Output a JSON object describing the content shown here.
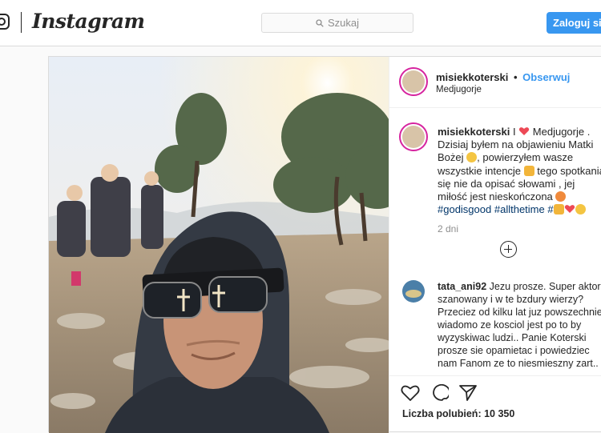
{
  "header": {
    "brand": "Instagram",
    "search_placeholder": "Szukaj",
    "login_label": "Zaloguj się"
  },
  "post": {
    "username": "misiekkoterski",
    "separator": "•",
    "follow_label": "Obserwuj",
    "location": "Medjugorje",
    "caption": {
      "username": "misiekkoterski",
      "t1": " I ",
      "t2": " Medjugorje . Dzisiaj byłem na objawieniu Matki Bożej ",
      "t3": ", powierzyłem wasze wszystkie intencje ",
      "t4": " tego spotkania się nie da opisać słowami , jej miłość jest nieskończona ",
      "hashtag1": "#godisgood",
      "hashtag2": "#allthetime",
      "hashtag3": "#"
    },
    "date": "2 dni",
    "comment": {
      "username": "tata_ani92",
      "text": "Jezu prosze. Super aktor szanowany i w te bzdury wierzy? Przeciez od kilku lat juz powszechnie wiadomo ze kosciol jest po to by wyzyskiwac ludzi.. Panie Koterski prosze sie opamietac i powiedziec nam Fanom ze to niesmieszny zart.."
    },
    "likes": "Liczba polubień: 10 350"
  },
  "colors": {
    "accent": "#3897f0",
    "ring": "#d6249f",
    "heart": "#ed4956"
  },
  "icons": [
    "instagram-glyph-icon",
    "search-icon",
    "heart-outline-icon",
    "comment-icon",
    "share-icon",
    "add-comment-icon"
  ]
}
